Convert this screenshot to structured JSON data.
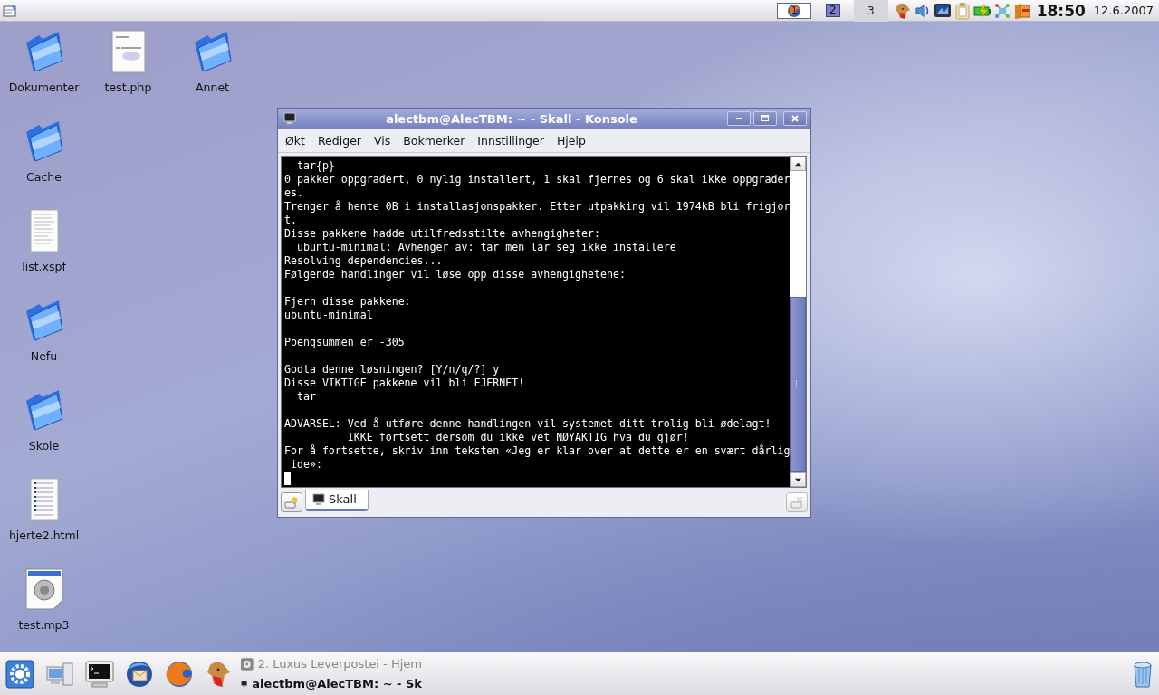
{
  "top_panel": {
    "pager": [
      {
        "label": "1",
        "selected": false,
        "kind": "app"
      },
      {
        "label": "2",
        "selected": false,
        "kind": "window"
      },
      {
        "label": "3",
        "selected": true,
        "kind": "empty"
      }
    ],
    "clock": {
      "time": "18:50",
      "date": "12.6.2007"
    }
  },
  "desktop_icons": [
    {
      "label": "Dokumenter",
      "kind": "folder"
    },
    {
      "label": "test.php",
      "kind": "php"
    },
    {
      "label": "Annet",
      "kind": "folder"
    },
    {
      "label": "Cache",
      "kind": "folder"
    },
    {
      "label": "list.xspf",
      "kind": "text"
    },
    {
      "label": "Nefu",
      "kind": "folder"
    },
    {
      "label": "Skole",
      "kind": "folder"
    },
    {
      "label": "hjerte2.html",
      "kind": "html"
    },
    {
      "label": "test.mp3",
      "kind": "audio"
    }
  ],
  "window": {
    "title": "alectbm@AlecTBM: ~ - Skall - Konsole",
    "menu": [
      "Økt",
      "Rediger",
      "Vis",
      "Bokmerker",
      "Innstillinger",
      "Hjelp"
    ],
    "terminal": {
      "output": "  tar{p}\n0 pakker oppgradert, 0 nylig installert, 1 skal fjernes og 6 skal ikke oppgrader\nes.\nTrenger å hente 0B i installasjonspakker. Etter utpakking vil 1974kB bli frigjor\nt.\nDisse pakkene hadde utilfredsstilte avhengigheter:\n  ubuntu-minimal: Avhenger av: tar men lar seg ikke installere\nResolving dependencies...\nFølgende handlinger vil løse opp disse avhengighetene:\n\nFjern disse pakkene:\nubuntu-minimal\n\nPoengsummen er -305\n\nGodta denne løsningen? [Y/n/q/?] y\nDisse VIKTIGE pakkene vil bli FJERNET!\n  tar\n\nADVARSEL: Ved å utføre denne handlingen vil systemet ditt trolig bli ødelagt!\n          IKKE fortsett dersom du ikke vet NØYAKTIG hva du gjør!\nFor å fortsette, skriv inn teksten «Jeg er klar over at dette er en svært dårlig\n ide»:",
      "cursor": true
    },
    "tabs": [
      {
        "label": "Skall",
        "selected": true
      }
    ]
  },
  "bottom_panel": {
    "tasks": [
      {
        "label": "2. Luxus Leverpostei - Hjem",
        "selected": false,
        "kind": "disc"
      },
      {
        "label": "alectbm@AlecTBM: ~ - Sk",
        "selected": true,
        "kind": "terminal"
      }
    ]
  }
}
